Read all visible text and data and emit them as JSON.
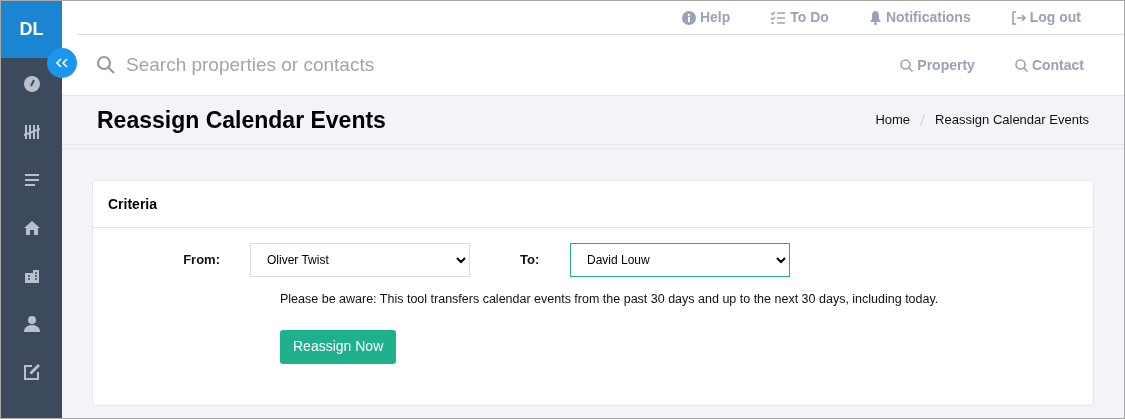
{
  "sidebar": {
    "logo": "DL"
  },
  "top_links": [
    {
      "kind": "help",
      "label": "Help"
    },
    {
      "kind": "todo",
      "label": "To Do"
    },
    {
      "kind": "bell",
      "label": "Notifications"
    },
    {
      "kind": "logout",
      "label": "Log out"
    }
  ],
  "search": {
    "placeholder": "Search properties or contacts",
    "links": [
      {
        "label": "Property"
      },
      {
        "label": "Contact"
      }
    ]
  },
  "page": {
    "title": "Reassign Calendar Events",
    "breadcrumb": [
      "Home",
      "Reassign Calendar Events"
    ]
  },
  "card": {
    "title": "Criteria",
    "fields": [
      {
        "label": "From:",
        "value": "Oliver Twist",
        "focused": false
      },
      {
        "label": "To:",
        "value": "David Louw",
        "focused": true
      }
    ],
    "note": "Please be aware: This tool transfers calendar events from the past 30 days and up to the next 30 days, including today.",
    "button": "Reassign Now"
  }
}
